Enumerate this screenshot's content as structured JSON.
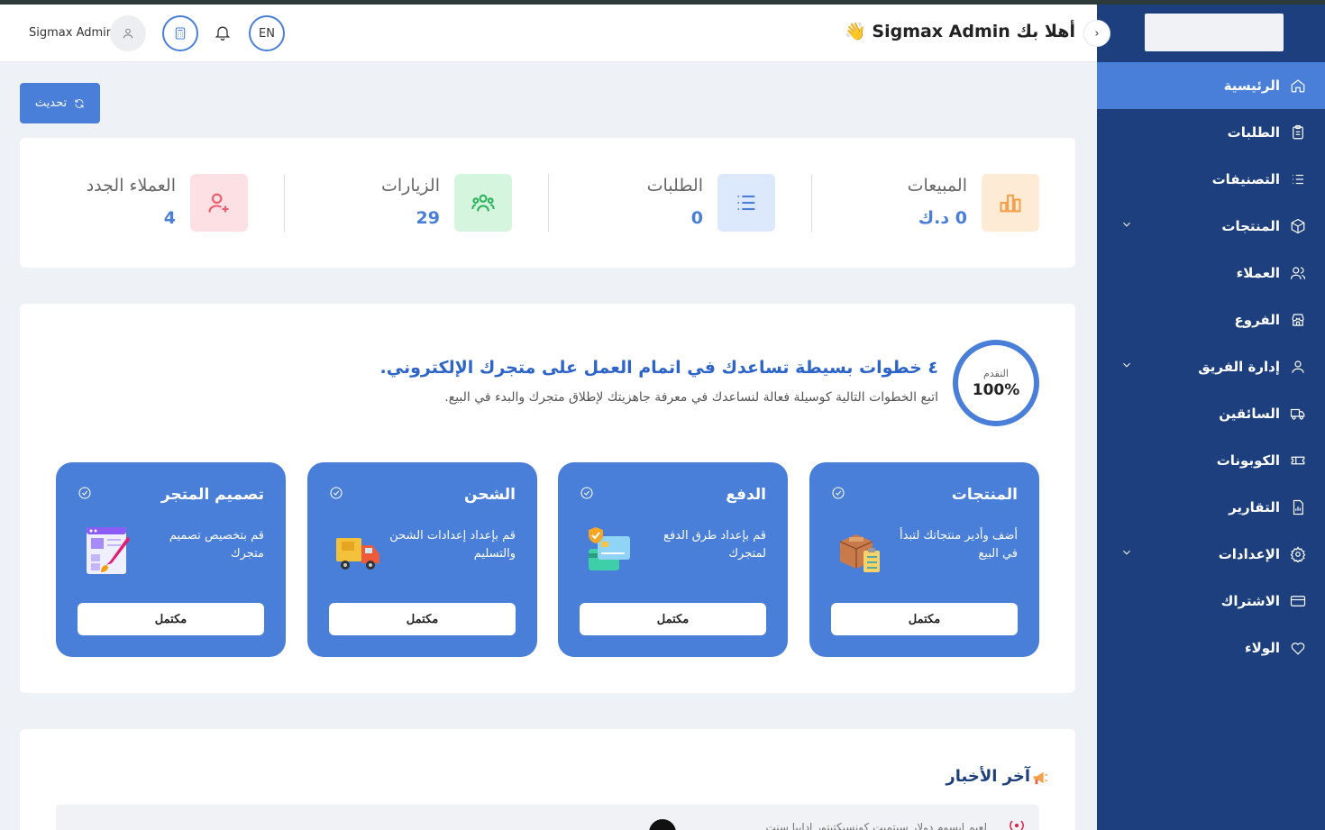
{
  "header": {
    "welcome": "أهلا بك Sigmax Admin 👋",
    "user_name": "Sigmax Admin",
    "language": "EN"
  },
  "toolbar": {
    "refresh_label": "تحديث"
  },
  "sidebar": {
    "items": [
      {
        "label": "الرئيسية",
        "icon": "home-icon",
        "active": true
      },
      {
        "label": "الطلبات",
        "icon": "clipboard-icon"
      },
      {
        "label": "التصنيفات",
        "icon": "list-icon"
      },
      {
        "label": "المنتجات",
        "icon": "box-icon",
        "expandable": true
      },
      {
        "label": "العملاء",
        "icon": "users-icon"
      },
      {
        "label": "الفروع",
        "icon": "store-icon"
      },
      {
        "label": "إدارة الفريق",
        "icon": "user-icon",
        "expandable": true
      },
      {
        "label": "السائقين",
        "icon": "truck-icon"
      },
      {
        "label": "الكوبونات",
        "icon": "ticket-icon"
      },
      {
        "label": "التقارير",
        "icon": "report-icon"
      },
      {
        "label": "الإعدادات",
        "icon": "gear-icon",
        "expandable": true
      },
      {
        "label": "الاشتراك",
        "icon": "card-icon"
      },
      {
        "label": "الولاء",
        "icon": "heart-icon"
      }
    ]
  },
  "stats": [
    {
      "label": "المبيعات",
      "value": "0 د.ك",
      "icon": "chart-bar-icon",
      "color": "#f5a04a",
      "bg": "#fdebd6"
    },
    {
      "label": "الطلبات",
      "value": "0",
      "icon": "list-icon",
      "color": "#4a7fd9",
      "bg": "#dce8fb"
    },
    {
      "label": "الزيارات",
      "value": "29",
      "icon": "users-icon",
      "color": "#2bb35a",
      "bg": "#d6f5df"
    },
    {
      "label": "العملاء الجدد",
      "value": "4",
      "icon": "user-plus-icon",
      "color": "#ef5b6a",
      "bg": "#fde0e3"
    }
  ],
  "onboarding": {
    "progress_label": "التقدم",
    "progress_value": "100%",
    "title": "٤ خطوات بسيطة تساعدك في اتمام العمل على متجرك الإلكتروني.",
    "subtitle": "اتبع الخطوات التالية كوسيلة فعالة لنساعدك في معرفة جاهزيتك لإطلاق متجرك والبدء في البيع.",
    "steps": [
      {
        "title": "المنتجات",
        "desc": "أضف وأدير منتجاتك لتبدأ في البيع",
        "button": "مكتمل",
        "illustration": "boxes-illustration"
      },
      {
        "title": "الدفع",
        "desc": "قم بإعداد طرق الدفع لمتجرك",
        "button": "مكتمل",
        "illustration": "cards-illustration"
      },
      {
        "title": "الشحن",
        "desc": "قم بإعداد إعدادات الشحن والتسليم",
        "button": "مكتمل",
        "illustration": "truck-illustration"
      },
      {
        "title": "تصميم المتجر",
        "desc": "قم بتخصيص تصميم متجرك",
        "button": "مكتمل",
        "illustration": "design-illustration"
      }
    ]
  },
  "news": {
    "title": "آخر الأخبار",
    "first_item": "لعيم ابسوم دولار سيتميت كونسيكتيتور ادايبا سنت"
  }
}
